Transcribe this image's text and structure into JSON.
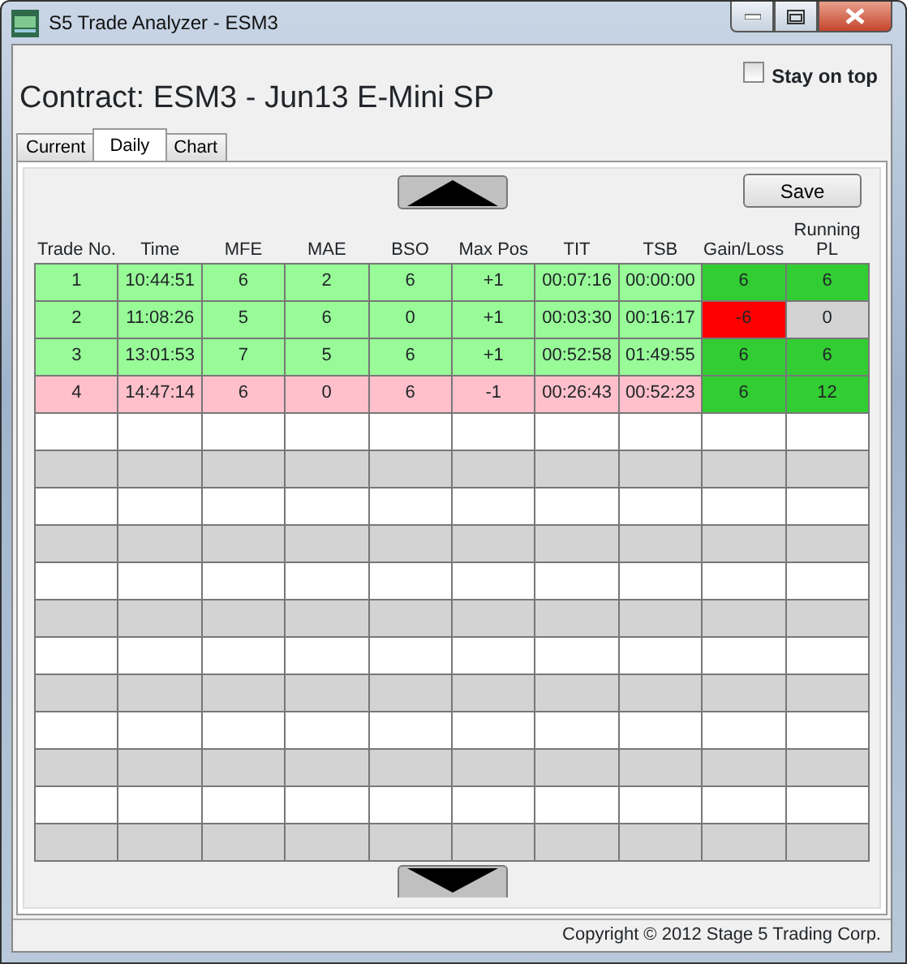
{
  "window": {
    "title": "S5 Trade Analyzer - ESM3"
  },
  "contract": "Contract: ESM3 - Jun13 E-Mini SP",
  "stay_on_top": {
    "label": "Stay on top",
    "checked": false
  },
  "tabs": [
    {
      "label": "Current",
      "selected": false
    },
    {
      "label": "Daily",
      "selected": true
    },
    {
      "label": "Chart",
      "selected": false
    }
  ],
  "save_button": "Save",
  "table": {
    "columns": [
      "Trade No.",
      "Time",
      "MFE",
      "MAE",
      "BSO",
      "Max Pos",
      "TIT",
      "TSB",
      "Gain/Loss",
      "Running PL"
    ],
    "rows": [
      {
        "color": "#98fb98",
        "cells": [
          "1",
          "10:44:51",
          "6",
          "2",
          "6",
          "+1",
          "00:07:16",
          "00:00:00"
        ],
        "gain_loss": {
          "text": "6",
          "color": "#32cd32"
        },
        "running_pl": {
          "text": "6",
          "color": "#32cd32"
        }
      },
      {
        "color": "#98fb98",
        "cells": [
          "2",
          "11:08:26",
          "5",
          "6",
          "0",
          "+1",
          "00:03:30",
          "00:16:17"
        ],
        "gain_loss": {
          "text": "-6",
          "color": "#ff0000"
        },
        "running_pl": {
          "text": "0",
          "color": "#d3d3d3"
        }
      },
      {
        "color": "#98fb98",
        "cells": [
          "3",
          "13:01:53",
          "7",
          "5",
          "6",
          "+1",
          "00:52:58",
          "01:49:55"
        ],
        "gain_loss": {
          "text": "6",
          "color": "#32cd32"
        },
        "running_pl": {
          "text": "6",
          "color": "#32cd32"
        }
      },
      {
        "color": "#ffc0cb",
        "cells": [
          "4",
          "14:47:14",
          "6",
          "0",
          "6",
          "-1",
          "00:26:43",
          "00:52:23"
        ],
        "gain_loss": {
          "text": "6",
          "color": "#32cd32"
        },
        "running_pl": {
          "text": "12",
          "color": "#32cd32"
        }
      }
    ]
  },
  "status_bar": "Copyright © 2012 Stage 5 Trading Corp."
}
